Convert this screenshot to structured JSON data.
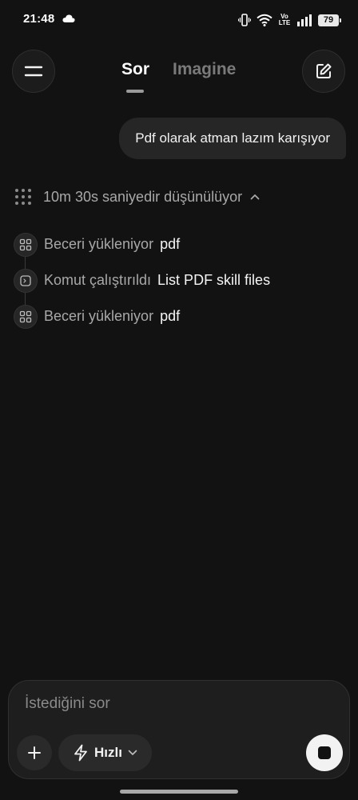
{
  "status": {
    "time": "21:48",
    "volte_top": "Vo",
    "volte_bottom": "LTE",
    "battery": "79"
  },
  "header": {
    "tabs": [
      {
        "label": "Sor",
        "active": true
      },
      {
        "label": "Imagine",
        "active": false
      }
    ]
  },
  "chat": {
    "user_message": "Pdf olarak atman lazım karışıyor",
    "thinking": "10m 30s saniyedir düşünülüyor",
    "steps": [
      {
        "icon": "skill-icon",
        "label": "Beceri yükleniyor",
        "detail": "pdf"
      },
      {
        "icon": "terminal-icon",
        "label": "Komut çalıştırıldı",
        "detail": "List PDF skill files"
      },
      {
        "icon": "skill-icon",
        "label": "Beceri yükleniyor",
        "detail": "pdf"
      }
    ]
  },
  "composer": {
    "placeholder": "İstediğini sor",
    "mode_label": "Hızlı"
  }
}
